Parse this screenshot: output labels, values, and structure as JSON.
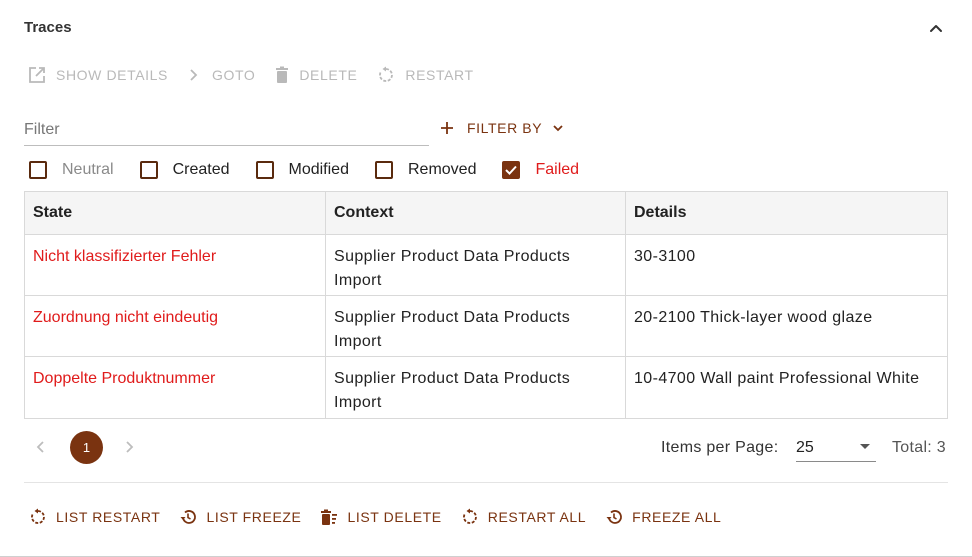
{
  "panel": {
    "title": "Traces"
  },
  "toolbar": {
    "show_details": "SHOW DETAILS",
    "goto": "GOTO",
    "delete": "DELETE",
    "restart": "RESTART"
  },
  "filter": {
    "placeholder": "Filter",
    "value": "",
    "filter_by_label": "FILTER BY"
  },
  "state_filters": [
    {
      "label": "Neutral",
      "checked": false
    },
    {
      "label": "Created",
      "checked": false
    },
    {
      "label": "Modified",
      "checked": false
    },
    {
      "label": "Removed",
      "checked": false
    },
    {
      "label": "Failed",
      "checked": true
    }
  ],
  "table": {
    "columns": [
      "State",
      "Context",
      "Details"
    ],
    "rows": [
      {
        "state": "Nicht klassifizierter Fehler",
        "context": "Supplier Product Data Products Import",
        "details": "30-3100"
      },
      {
        "state": "Zuordnung nicht eindeutig",
        "context": "Supplier Product Data Products Import",
        "details": "20-2100 Thick-layer wood glaze"
      },
      {
        "state": "Doppelte Produktnummer",
        "context": "Supplier Product Data Products Import",
        "details": "10-4700 Wall paint Professional White"
      }
    ]
  },
  "pagination": {
    "current_page": "1",
    "items_per_page_label": "Items per Page:",
    "items_per_page_value": "25",
    "total_label": "Total: 3"
  },
  "actions": {
    "list_restart": "LIST RESTART",
    "list_freeze": "LIST FREEZE",
    "list_delete": "LIST DELETE",
    "restart_all": "RESTART ALL",
    "freeze_all": "FREEZE ALL"
  },
  "colors": {
    "accent": "#7a3310",
    "error": "#e01b1b",
    "disabled": "#b9b9b9"
  }
}
